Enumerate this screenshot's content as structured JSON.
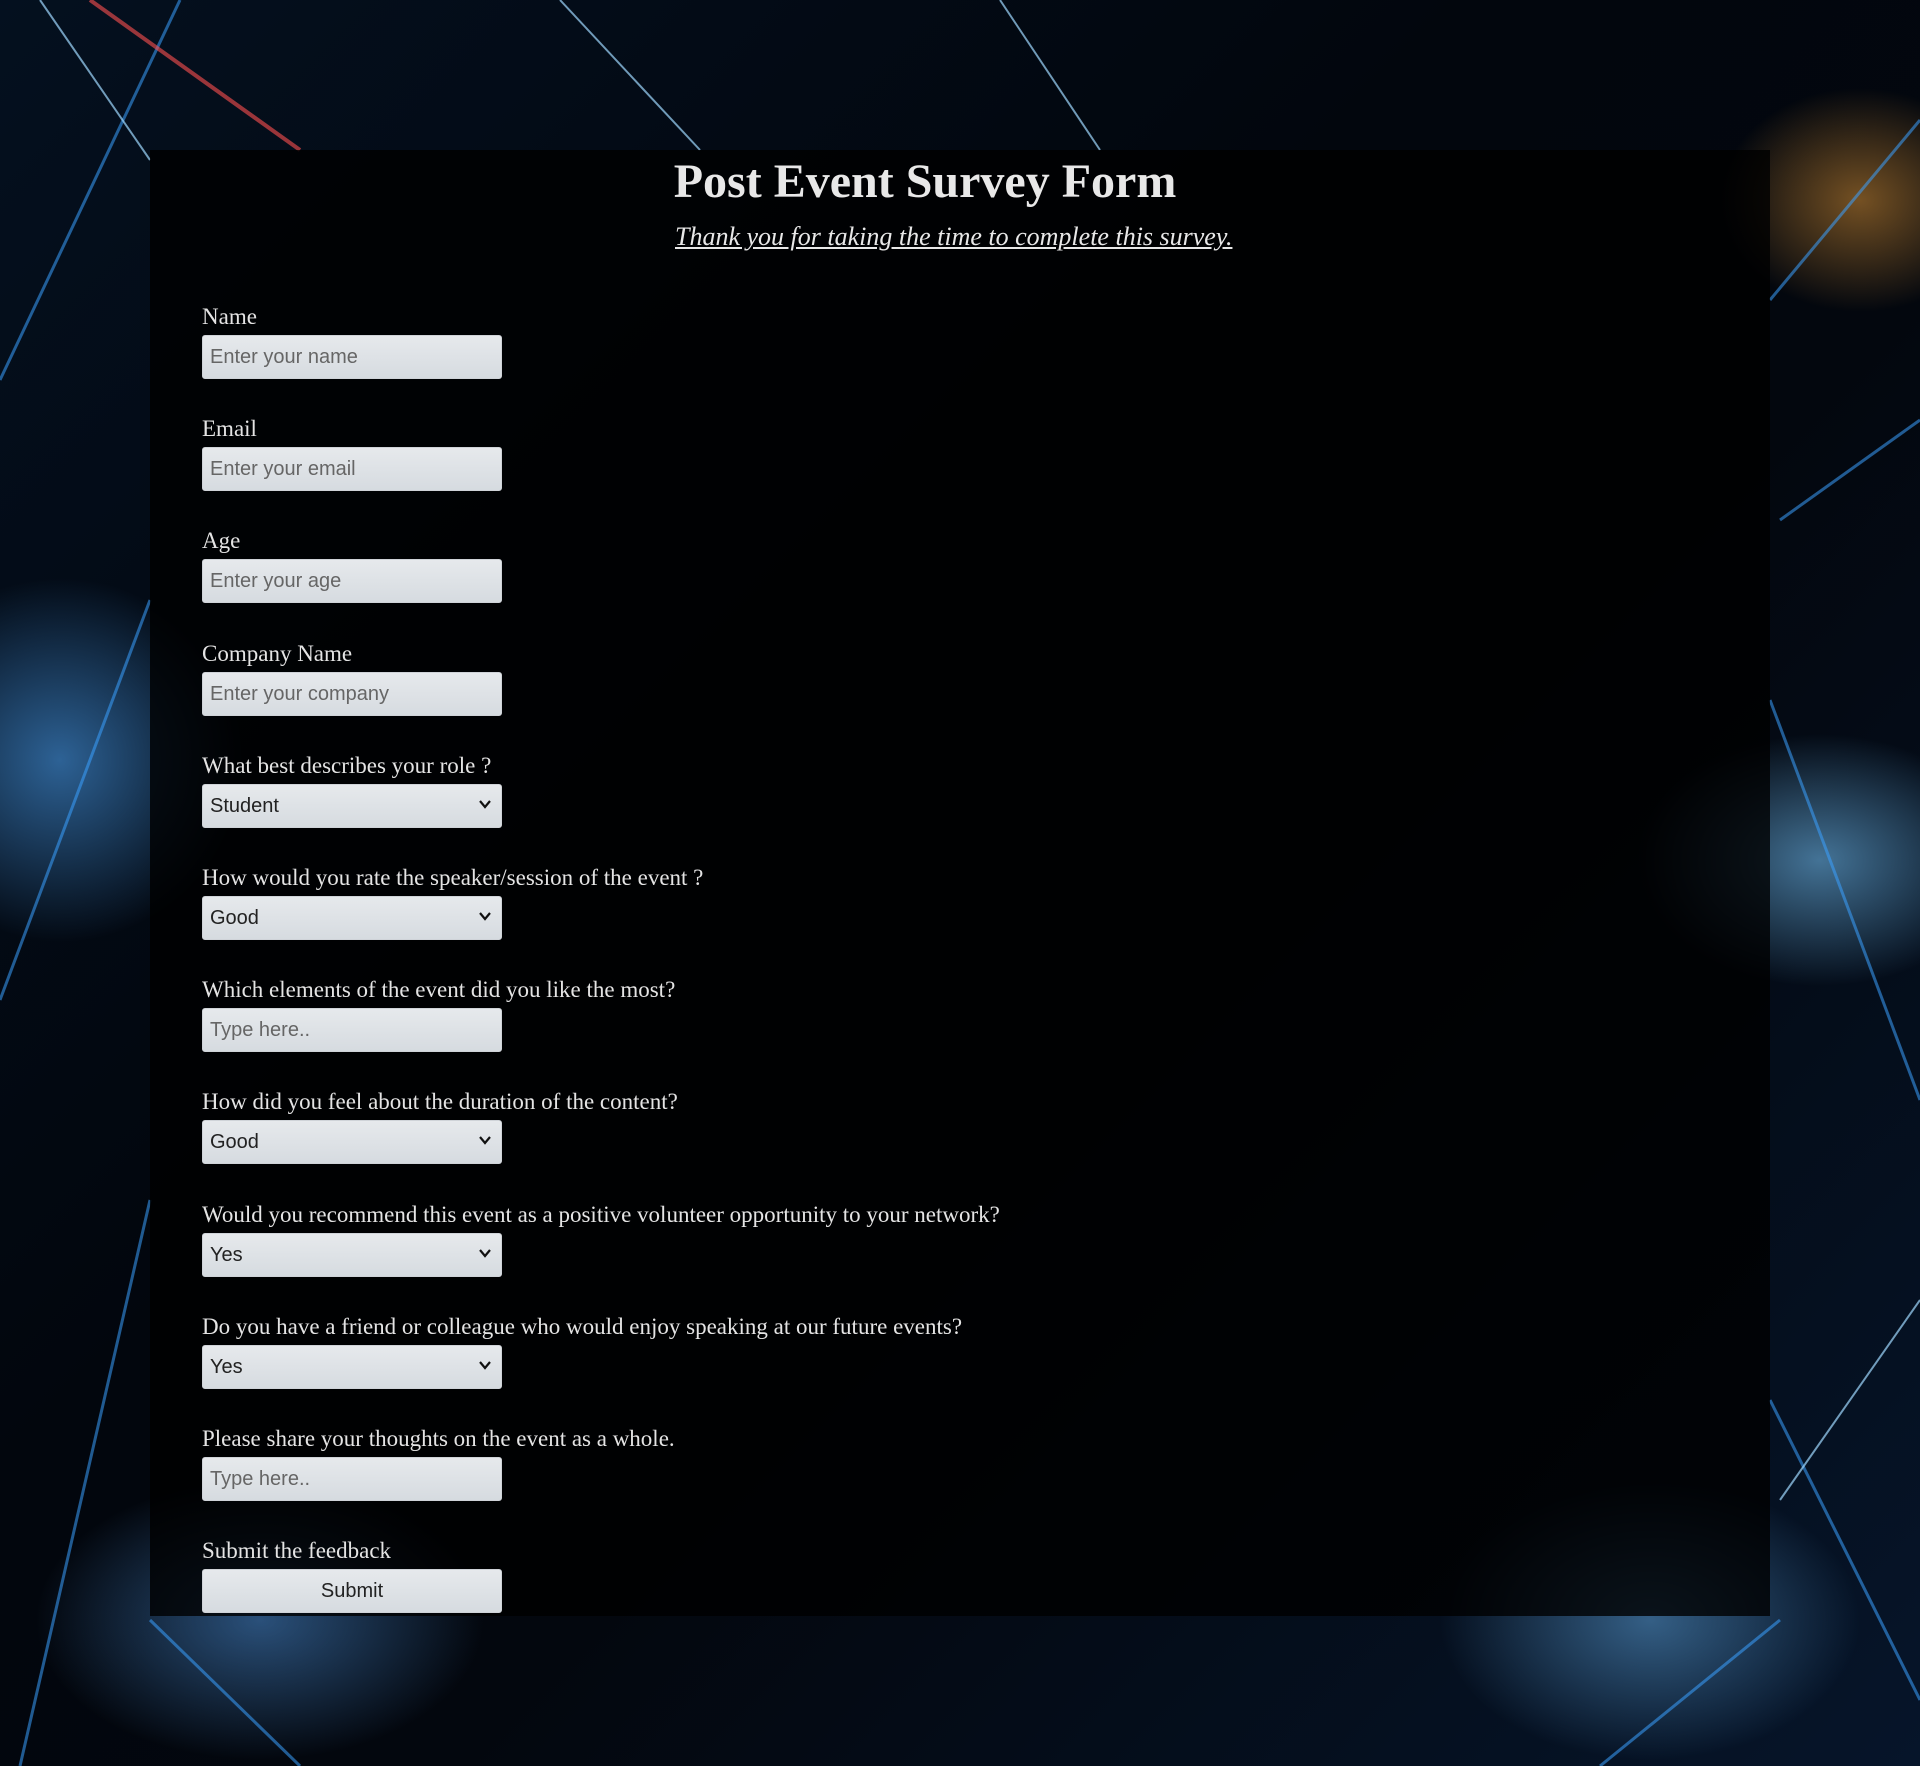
{
  "form": {
    "title": "Post Event Survey Form",
    "subtitle": "Thank you for taking the time to complete this survey.",
    "name": {
      "label": "Name",
      "placeholder": "Enter your name",
      "value": ""
    },
    "email": {
      "label": "Email",
      "placeholder": "Enter your email",
      "value": ""
    },
    "age": {
      "label": "Age",
      "placeholder": "Enter your age",
      "value": ""
    },
    "company": {
      "label": "Company Name",
      "placeholder": "Enter your company",
      "value": ""
    },
    "role": {
      "label": "What best describes your role ?",
      "selected": "Student"
    },
    "speaker_rating": {
      "label": "How would you rate the speaker/session of the event ?",
      "selected": "Good"
    },
    "liked_elements": {
      "label": "Which elements of the event did you like the most?",
      "placeholder": "Type here..",
      "value": ""
    },
    "duration": {
      "label": "How did you feel about the duration of the content?",
      "selected": "Good"
    },
    "recommend": {
      "label": "Would you recommend this event as a positive volunteer opportunity to your network?",
      "selected": "Yes"
    },
    "friend_speaker": {
      "label": "Do you have a friend or colleague who would enjoy speaking at our future events?",
      "selected": "Yes"
    },
    "thoughts": {
      "label": "Please share your thoughts on the event as a whole.",
      "placeholder": "Type here..",
      "value": ""
    },
    "submit": {
      "label": "Submit the feedback",
      "button_label": "Submit"
    }
  },
  "colors": {
    "panel_background": "#000000",
    "text": "#e4e4e4",
    "control_background": "#dde1e5"
  }
}
